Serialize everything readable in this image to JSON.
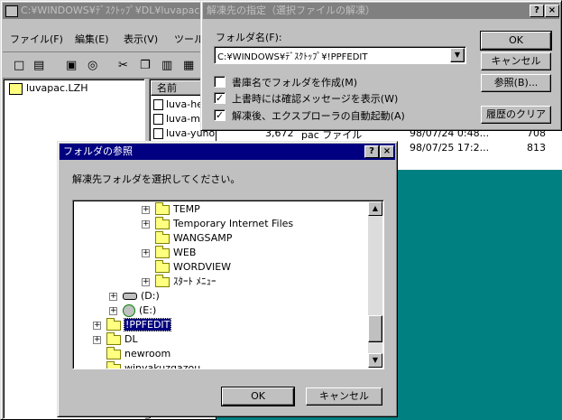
{
  "explorer": {
    "title": "C:¥WINDOWS¥ﾃﾞｽｸﾄｯﾌﾟ¥DL¥luvapac.LZH",
    "menu": [
      "ファイル(F)",
      "編集(E)",
      "表示(V)",
      "ツール"
    ],
    "tree_root": "luvapac.LZH",
    "column_name": "名前",
    "files": [
      {
        "name": "luva-he",
        "size": "",
        "type": "",
        "date": ""
      },
      {
        "name": "luva-m",
        "size": "",
        "type": "",
        "date": ""
      },
      {
        "name": "luva-yuhomi.pac",
        "size": "3,672",
        "type": "pac ファイル",
        "date": "98/07/24 0:48...",
        "col": "708"
      },
      {
        "name": "",
        "size": "",
        "type": "",
        "date": "98/07/25 17:2...",
        "col": "813"
      }
    ]
  },
  "extract_dialog": {
    "title": "解凍先の指定（選択ファイルの解凍）",
    "folder_label": "フォルダ名(F):",
    "folder_value": "C:¥WINDOWS¥ﾃﾞｽｸﾄｯﾌﾟ¥!PPFEDIT",
    "options": [
      {
        "label": "書庫名でフォルダを作成(M)",
        "checked": false
      },
      {
        "label": "上書時には確認メッセージを表示(W)",
        "checked": true
      },
      {
        "label": "解凍後、エクスプローラの自動起動(A)",
        "checked": true
      }
    ],
    "ok": "OK",
    "cancel": "キャンセル",
    "browse": "参照(B)...",
    "clear_history": "履歴のクリア"
  },
  "browse_dialog": {
    "title": "フォルダの参照",
    "prompt": "解凍先フォルダを選択してください。",
    "tree": [
      {
        "label": "TEMP",
        "level": 3,
        "expander": "+"
      },
      {
        "label": "Temporary Internet Files",
        "level": 3,
        "expander": "+"
      },
      {
        "label": "WANGSAMP",
        "level": 3,
        "expander": ""
      },
      {
        "label": "WEB",
        "level": 3,
        "expander": "+"
      },
      {
        "label": "WORDVIEW",
        "level": 3,
        "expander": ""
      },
      {
        "label": "ｽﾀｰﾄ ﾒﾆｭｰ",
        "level": 3,
        "expander": "+"
      },
      {
        "label": "(D:)",
        "level": 1,
        "expander": "+",
        "icon": "drive"
      },
      {
        "label": "(E:)",
        "level": 1,
        "expander": "+",
        "icon": "cdrom"
      },
      {
        "label": "!PPFEDIT",
        "level": 0,
        "expander": "+",
        "selected": true
      },
      {
        "label": "DL",
        "level": 0,
        "expander": "+"
      },
      {
        "label": "newroom",
        "level": 0,
        "expander": ""
      },
      {
        "label": "winyakuzgazou",
        "level": 0,
        "expander": ""
      }
    ],
    "ok": "OK",
    "cancel": "キャンセル"
  },
  "colors": {
    "desktop": "#008080",
    "active_title": "#000080",
    "inactive_title": "#808080",
    "face": "#c0c0c0"
  }
}
